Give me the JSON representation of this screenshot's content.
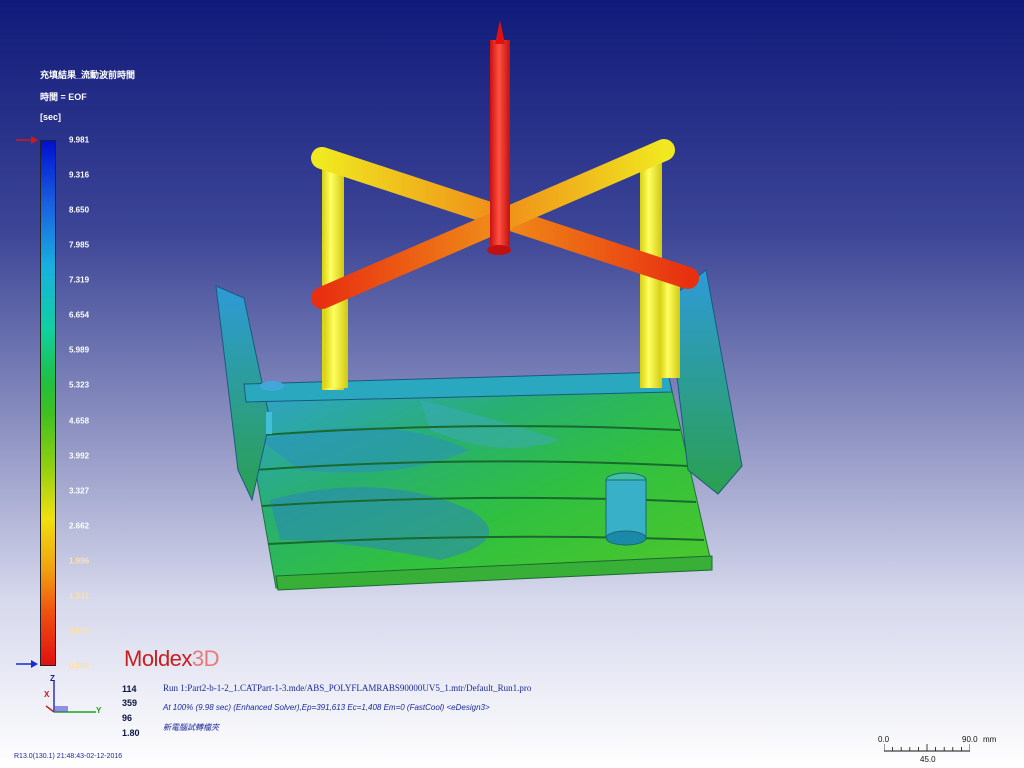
{
  "legend": {
    "title": "充填結果_流動波前時間",
    "time": "時間 = EOF",
    "unit": "[sec]",
    "ticks": [
      "9.981",
      "9.316",
      "8.650",
      "7.985",
      "7.319",
      "6.654",
      "5.989",
      "5.323",
      "4.658",
      "3.992",
      "3.327",
      "2.662",
      "1.996",
      "1.331",
      "0.665",
      "0.000"
    ],
    "marker_color": "#d01818"
  },
  "logo": {
    "main": "Moldex",
    "suffix": "3D"
  },
  "stats": [
    "114",
    "359",
    "96",
    "1.80"
  ],
  "info": {
    "run_line": "Run 1:Part2-b-1-2_1.CATPart-1-3.mde/ABS_POLYFLAMRABS90000UV5_1.mtr/Default_Run1.pro",
    "solver_line": "At 100% (9.98 sec) (Enhanced Solver),Ep=391,613 Ec=1,408 Em=0 (FastCool) <eDesign3>",
    "note_line": "新電腦試轉檔夾"
  },
  "version": "R13.0(130.1) 21:48:43-02-12-2016",
  "scale": {
    "left": "0.0",
    "right": "90.0",
    "unit": "mm",
    "mid": "45.0"
  },
  "axes": {
    "z": "Z",
    "x": "X",
    "y": "Y"
  }
}
